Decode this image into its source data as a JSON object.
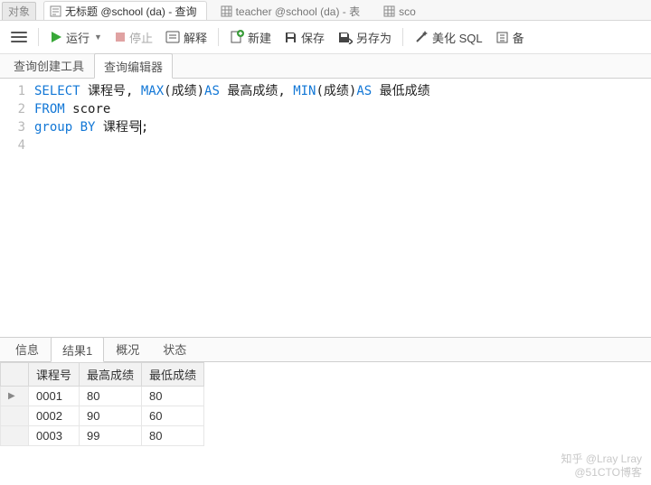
{
  "titlebar": {
    "object_label": "对象",
    "tabs": [
      {
        "icon": "query",
        "label": "无标题 @school (da) - 查询",
        "active": true
      },
      {
        "icon": "table",
        "label": "teacher @school (da) - 表",
        "active": false
      },
      {
        "icon": "table",
        "label": "sco",
        "active": false
      }
    ]
  },
  "toolbar": {
    "run": "运行",
    "stop": "停止",
    "explain": "解释",
    "new": "新建",
    "save": "保存",
    "saveas": "另存为",
    "beautify": "美化 SQL",
    "backup": "备"
  },
  "subtabs": {
    "builder": "查询创建工具",
    "editor": "查询编辑器",
    "active": 1
  },
  "sql": {
    "lines": [
      {
        "n": "1",
        "tokens": [
          {
            "t": "SELECT ",
            "k": 1
          },
          {
            "t": "课程号, "
          },
          {
            "t": "MAX",
            "k": 1
          },
          {
            "t": "(成绩)"
          },
          {
            "t": "AS ",
            "k": 1
          },
          {
            "t": "最高成绩, "
          },
          {
            "t": "MIN",
            "k": 1
          },
          {
            "t": "(成绩)"
          },
          {
            "t": "AS ",
            "k": 1
          },
          {
            "t": "最低成绩"
          }
        ]
      },
      {
        "n": "2",
        "tokens": [
          {
            "t": "FROM ",
            "k": 1
          },
          {
            "t": "score"
          }
        ]
      },
      {
        "n": "3",
        "tokens": [
          {
            "t": "group ",
            "k": 1
          },
          {
            "t": "BY ",
            "k": 1
          },
          {
            "t": "课程号",
            "caret": true
          },
          {
            "t": ";"
          }
        ]
      },
      {
        "n": "4",
        "tokens": []
      }
    ]
  },
  "result_tabs": {
    "items": [
      "信息",
      "结果1",
      "概况",
      "状态"
    ],
    "active": 1
  },
  "grid": {
    "columns": [
      "课程号",
      "最高成绩",
      "最低成绩"
    ],
    "rows": [
      {
        "marker": "▶",
        "cells": [
          "0001",
          "80",
          "80"
        ]
      },
      {
        "marker": "",
        "cells": [
          "0002",
          "90",
          "60"
        ]
      },
      {
        "marker": "",
        "cells": [
          "0003",
          "99",
          "80"
        ]
      }
    ]
  },
  "watermark": {
    "line1": "知乎 @Lray Lray",
    "line2": "@51CTO博客"
  }
}
